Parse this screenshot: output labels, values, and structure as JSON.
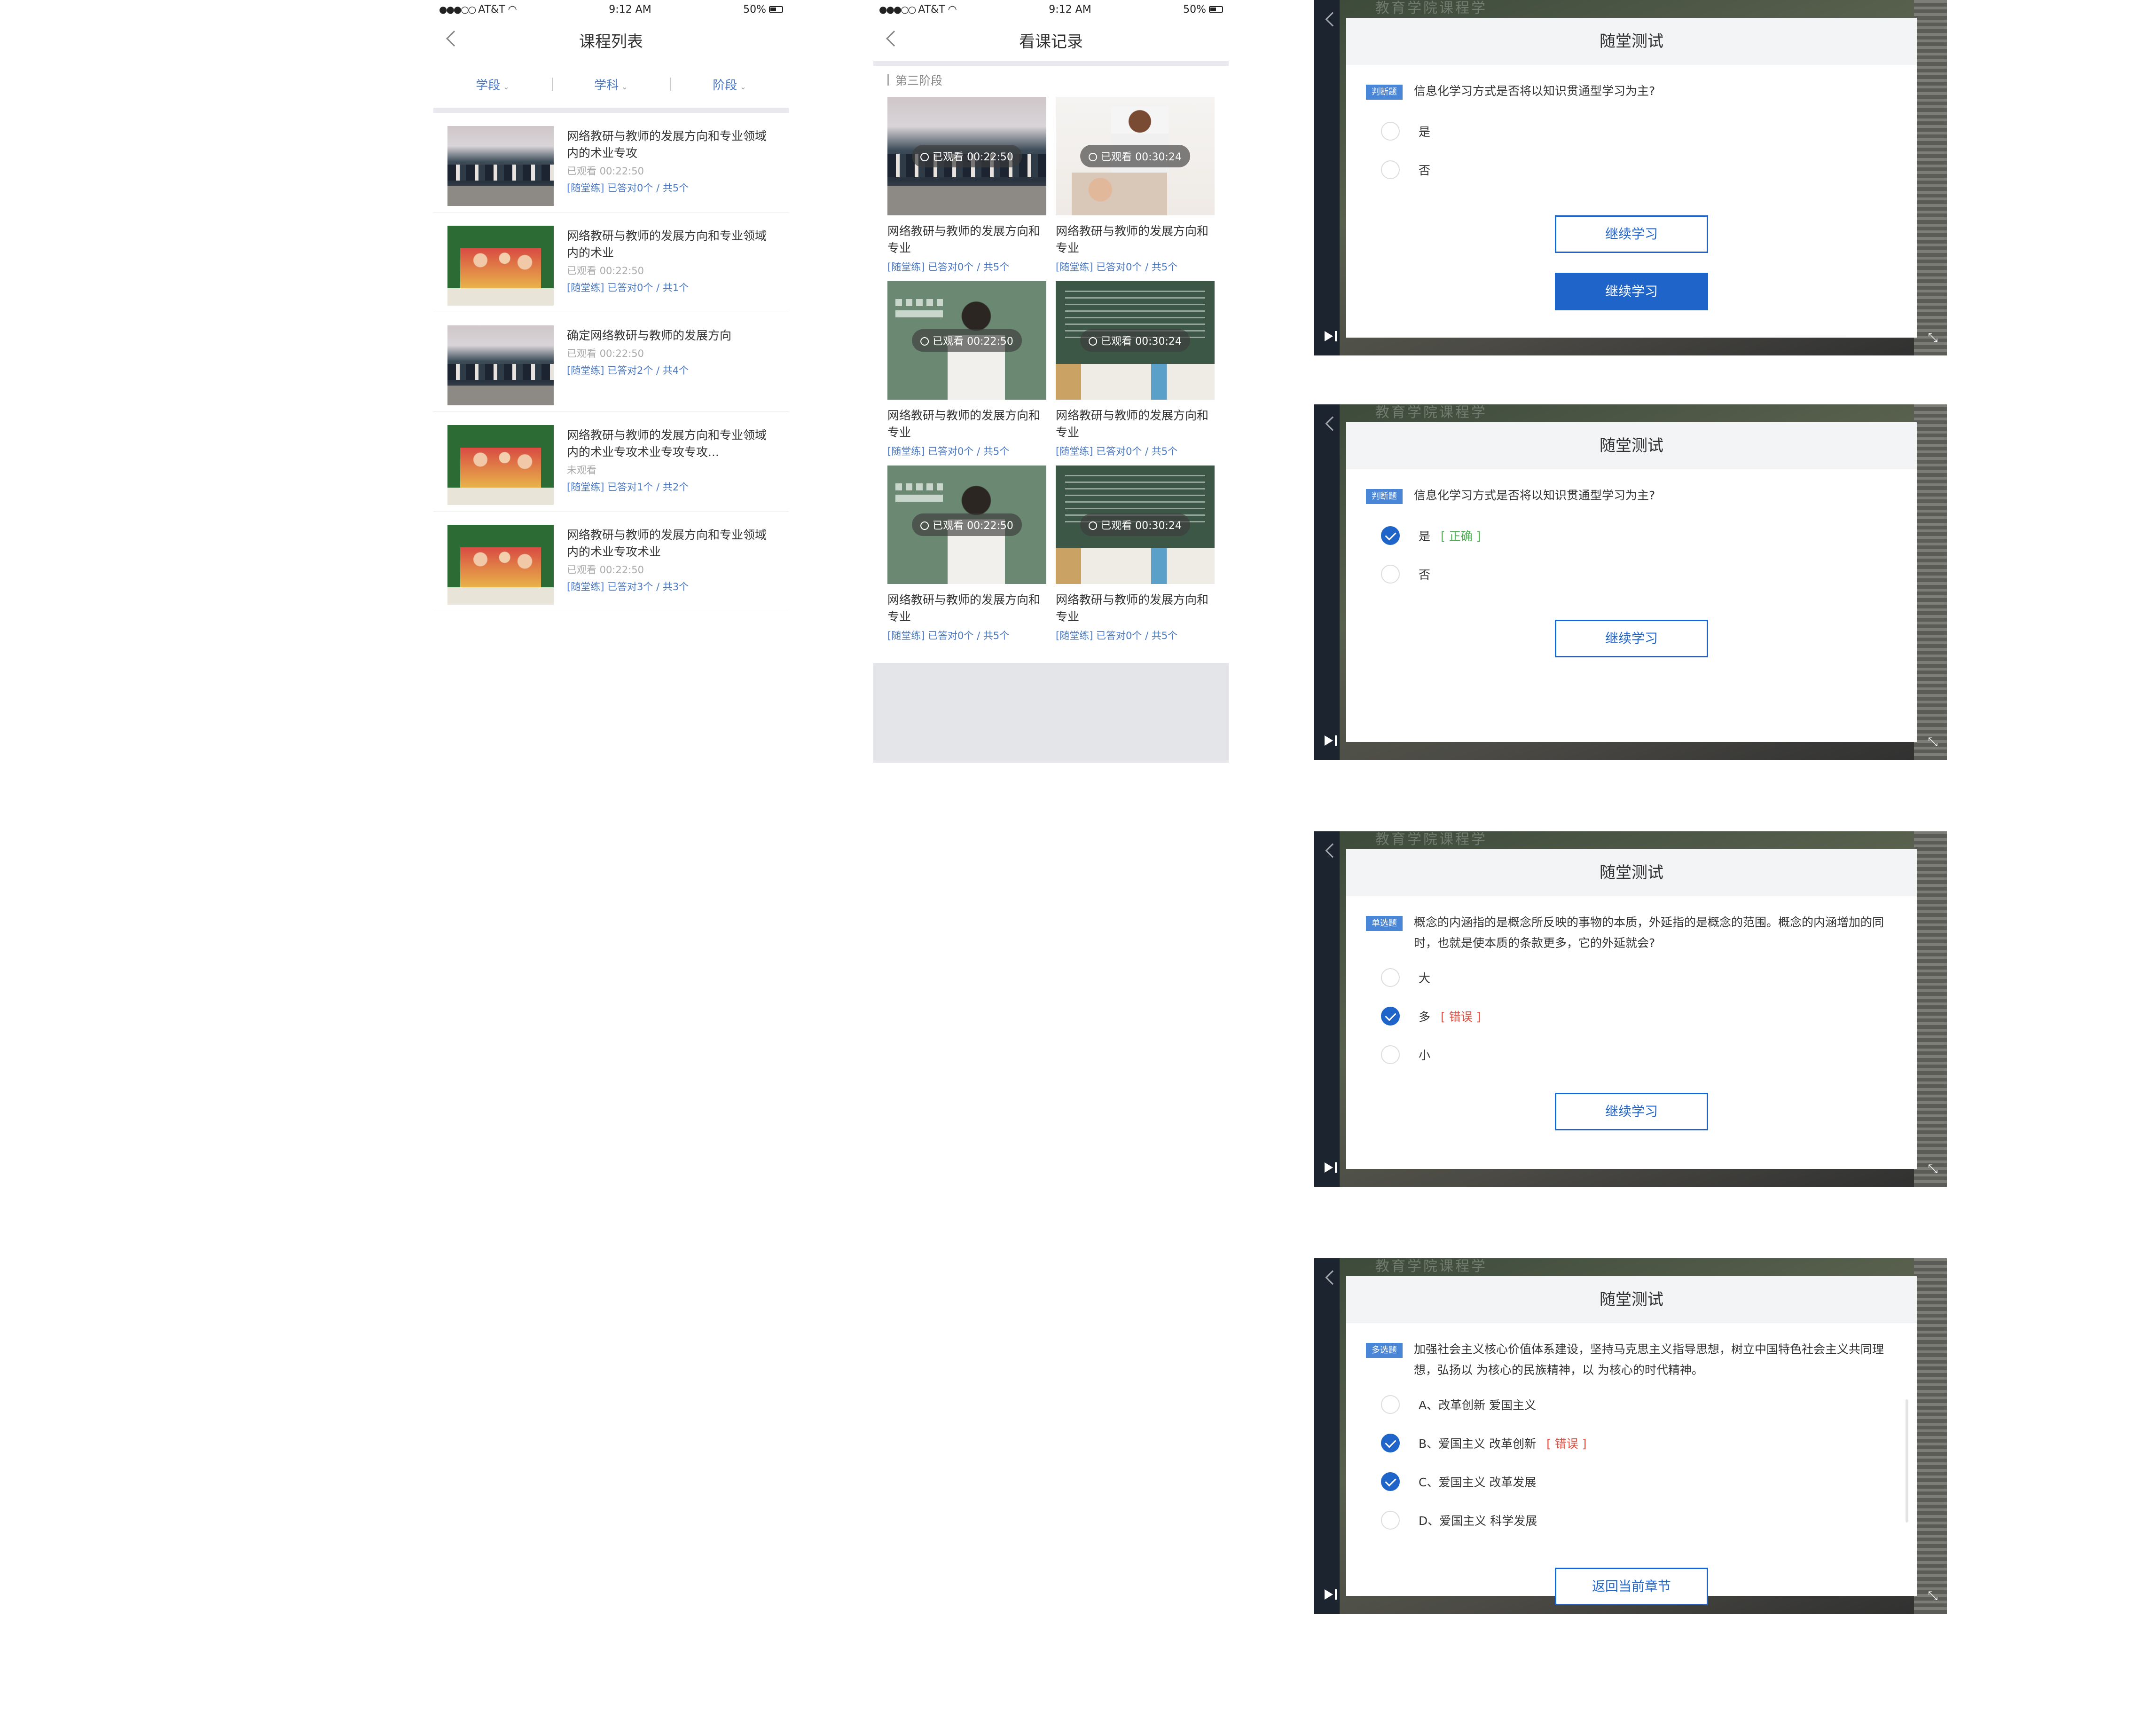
{
  "status": {
    "carrier": "AT&T",
    "time": "9:12 AM",
    "battery": "50%"
  },
  "course_list": {
    "title": "课程列表",
    "filters": [
      "学段",
      "学科",
      "阶段"
    ],
    "items": [
      {
        "title": "网络教研与教师的发展方向和专业领域内的术业专攻",
        "meta": "已观看 00:22:50",
        "quiz": "[随堂练] 已答对0个 / 共5个",
        "thumb": "classroom"
      },
      {
        "title": "网络教研与教师的发展方向和专业领域内的术业",
        "meta": "已观看 00:22:50",
        "quiz": "[随堂练] 已答对0个 / 共1个",
        "thumb": "green-classroom"
      },
      {
        "title": "确定网络教研与教师的发展方向",
        "meta": "已观看 00:22:50",
        "quiz": "[随堂练] 已答对2个 / 共4个",
        "thumb": "classroom"
      },
      {
        "title": "网络教研与教师的发展方向和专业领域内的术业专攻术业专攻专攻...",
        "meta": "未观看",
        "quiz": "[随堂练] 已答对1个 / 共2个",
        "thumb": "green-classroom"
      },
      {
        "title": "网络教研与教师的发展方向和专业领域内的术业专攻术业",
        "meta": "已观看 00:22:50",
        "quiz": "[随堂练] 已答对3个 / 共3个",
        "thumb": "green-classroom"
      }
    ]
  },
  "watch_history": {
    "title": "看课记录",
    "section": "第三阶段",
    "cards": [
      {
        "watched": "已观看 00:22:50",
        "title": "网络教研与教师的发展方向和专业",
        "quiz": "[随堂练] 已答对0个 / 共5个",
        "thumb": "classroom"
      },
      {
        "watched": "已观看 00:30:24",
        "title": "网络教研与教师的发展方向和专业",
        "quiz": "[随堂练] 已答对0个 / 共5个",
        "thumb": "teacher"
      },
      {
        "watched": "已观看 00:22:50",
        "title": "网络教研与教师的发展方向和专业",
        "quiz": "[随堂练] 已答对0个 / 共5个",
        "thumb": "chalkboard"
      },
      {
        "watched": "已观看 00:30:24",
        "title": "网络教研与教师的发展方向和专业",
        "quiz": "[随堂练] 已答对0个 / 共5个",
        "thumb": "board"
      },
      {
        "watched": "已观看 00:22:50",
        "title": "网络教研与教师的发展方向和专业",
        "quiz": "[随堂练] 已答对0个 / 共5个",
        "thumb": "chalkboard"
      },
      {
        "watched": "已观看 00:30:24",
        "title": "网络教研与教师的发展方向和专业",
        "quiz": "[随堂练] 已答对0个 / 共5个",
        "thumb": "board"
      }
    ]
  },
  "quiz_dialogs": [
    {
      "video_title": "教育学院课程学",
      "title": "随堂测试",
      "tag": "判断题",
      "question": "信息化学习方式是否将以知识贯通型学习为主?",
      "options": [
        {
          "label": "是",
          "checked": false,
          "mark": ""
        },
        {
          "label": "否",
          "checked": false,
          "mark": ""
        }
      ],
      "buttons": [
        {
          "label": "继续学习",
          "style": "outline"
        },
        {
          "label": "继续学习",
          "style": "fill"
        }
      ]
    },
    {
      "video_title": "教育学院课程学",
      "title": "随堂测试",
      "tag": "判断题",
      "question": "信息化学习方式是否将以知识贯通型学习为主?",
      "options": [
        {
          "label": "是",
          "checked": true,
          "mark": "[ 正确 ]",
          "mark_type": "ok"
        },
        {
          "label": "否",
          "checked": false,
          "mark": ""
        }
      ],
      "buttons": [
        {
          "label": "继续学习",
          "style": "outline"
        }
      ]
    },
    {
      "video_title": "教育学院课程学",
      "title": "随堂测试",
      "tag": "单选题",
      "question": "概念的内涵指的是概念所反映的事物的本质，外延指的是概念的范围。概念的内涵增加的同时，也就是使本质的条款更多，它的外延就会?",
      "options": [
        {
          "label": "大",
          "checked": false,
          "mark": ""
        },
        {
          "label": "多",
          "checked": true,
          "mark": "[ 错误 ]",
          "mark_type": "err"
        },
        {
          "label": "小",
          "checked": false,
          "mark": ""
        }
      ],
      "buttons": [
        {
          "label": "继续学习",
          "style": "outline"
        }
      ]
    },
    {
      "video_title": "教育学院课程学",
      "title": "随堂测试",
      "tag": "多选题",
      "question": "加强社会主义核心价值体系建设，坚持马克思主义指导思想，树立中国特色社会主义共同理想，弘扬以 为核心的民族精神，以 为核心的时代精神。",
      "options": [
        {
          "label": "A、改革创新 爱国主义",
          "checked": false,
          "mark": ""
        },
        {
          "label": "B、爱国主义 改革创新",
          "checked": true,
          "mark": "[ 错误 ]",
          "mark_type": "err"
        },
        {
          "label": "C、爱国主义 改革发展",
          "checked": true,
          "mark": ""
        },
        {
          "label": "D、爱国主义 科学发展",
          "checked": false,
          "mark": ""
        }
      ],
      "buttons": [
        {
          "label": "返回当前章节",
          "style": "outline"
        }
      ]
    }
  ],
  "colors": {
    "accent": "#1f64c8",
    "link": "#4a78c2",
    "ok": "#48b04d",
    "error": "#e64a3b"
  }
}
